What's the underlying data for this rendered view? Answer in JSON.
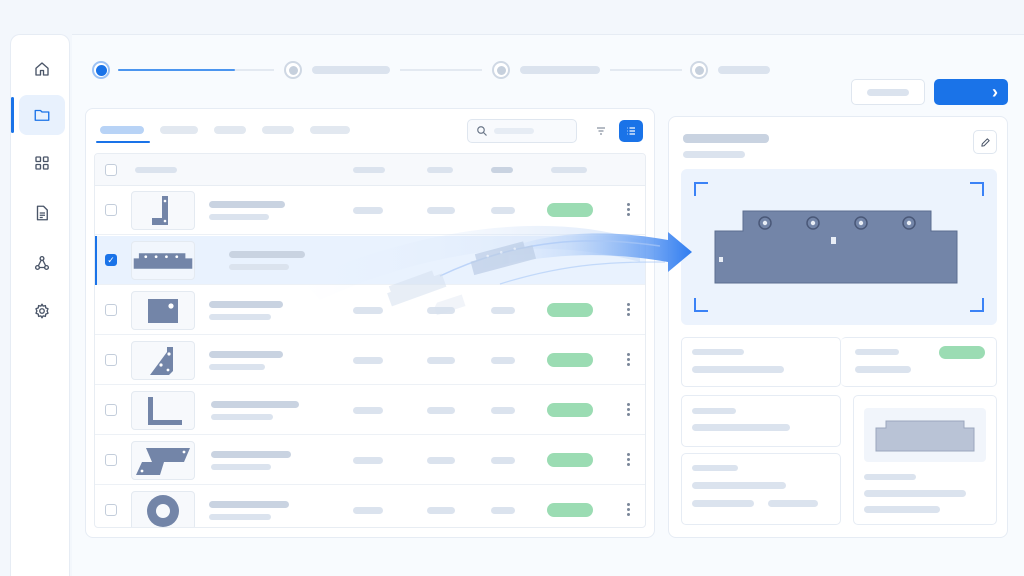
{
  "sidebar": {
    "items": [
      {
        "icon": "home-icon",
        "active": false
      },
      {
        "icon": "folder-icon",
        "active": true
      },
      {
        "icon": "grid-icon",
        "active": false
      },
      {
        "icon": "document-icon",
        "active": false
      },
      {
        "icon": "network-icon",
        "active": false
      },
      {
        "icon": "gear-icon",
        "active": false
      }
    ]
  },
  "stepper": {
    "steps": 4,
    "current": 1,
    "progress_in_current": 0.75
  },
  "toolbar": {
    "next_glyph": "›"
  },
  "list": {
    "active_tab": 0,
    "rows": [
      {
        "part": "l-bracket-shape",
        "selected": false,
        "status": "green"
      },
      {
        "part": "long-plate-shape",
        "selected": true,
        "status": "none"
      },
      {
        "part": "plate-hole-shape",
        "selected": false,
        "status": "green"
      },
      {
        "part": "gusset-shape",
        "selected": false,
        "status": "green"
      },
      {
        "part": "angle-shape",
        "selected": false,
        "status": "green"
      },
      {
        "part": "z-plate-shape",
        "selected": false,
        "status": "green"
      },
      {
        "part": "washer-shape",
        "selected": false,
        "status": "green"
      }
    ]
  },
  "colors": {
    "accent": "#1a73e8",
    "part_fill": "#7385a8",
    "status_green": "#9bdcb3",
    "selected_row": "#e9f2fe"
  },
  "check_glyph": "✓"
}
